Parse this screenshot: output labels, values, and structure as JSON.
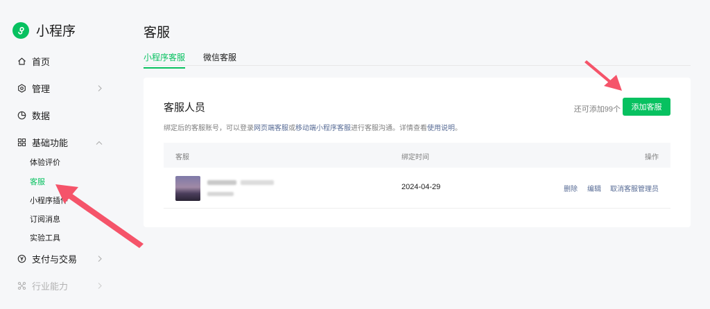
{
  "app": {
    "name": "小程序"
  },
  "sidebar": {
    "items": [
      {
        "label": "首页"
      },
      {
        "label": "管理"
      },
      {
        "label": "数据"
      },
      {
        "label": "基础功能"
      },
      {
        "label": "支付与交易"
      },
      {
        "label": "行业能力"
      }
    ],
    "subitems": [
      "体验评价",
      "客服",
      "小程序插件",
      "订阅消息",
      "实验工具"
    ],
    "active_sub": "客服"
  },
  "page": {
    "title": "客服"
  },
  "tabs": [
    {
      "label": "小程序客服",
      "active": true
    },
    {
      "label": "微信客服",
      "active": false
    }
  ],
  "card": {
    "title": "客服人员",
    "quota_text": "还可添加99个",
    "add_button": "添加客服",
    "desc": {
      "before": "绑定后的客服账号，可以登录",
      "link1": "网页端客服",
      "or": "或",
      "link2": "移动端小程序客服",
      "middle": "进行客服沟通。详情查看",
      "link3": "使用说明",
      "end": "。"
    }
  },
  "table": {
    "columns": [
      "客服",
      "绑定时间",
      "操作"
    ],
    "rows": [
      {
        "bind_time": "2024-04-29",
        "actions": [
          "删除",
          "编辑",
          "取消客服管理员"
        ]
      }
    ]
  },
  "colors": {
    "accent": "#07c160",
    "link": "#576b95",
    "annotation_arrow": "#f5546a"
  }
}
